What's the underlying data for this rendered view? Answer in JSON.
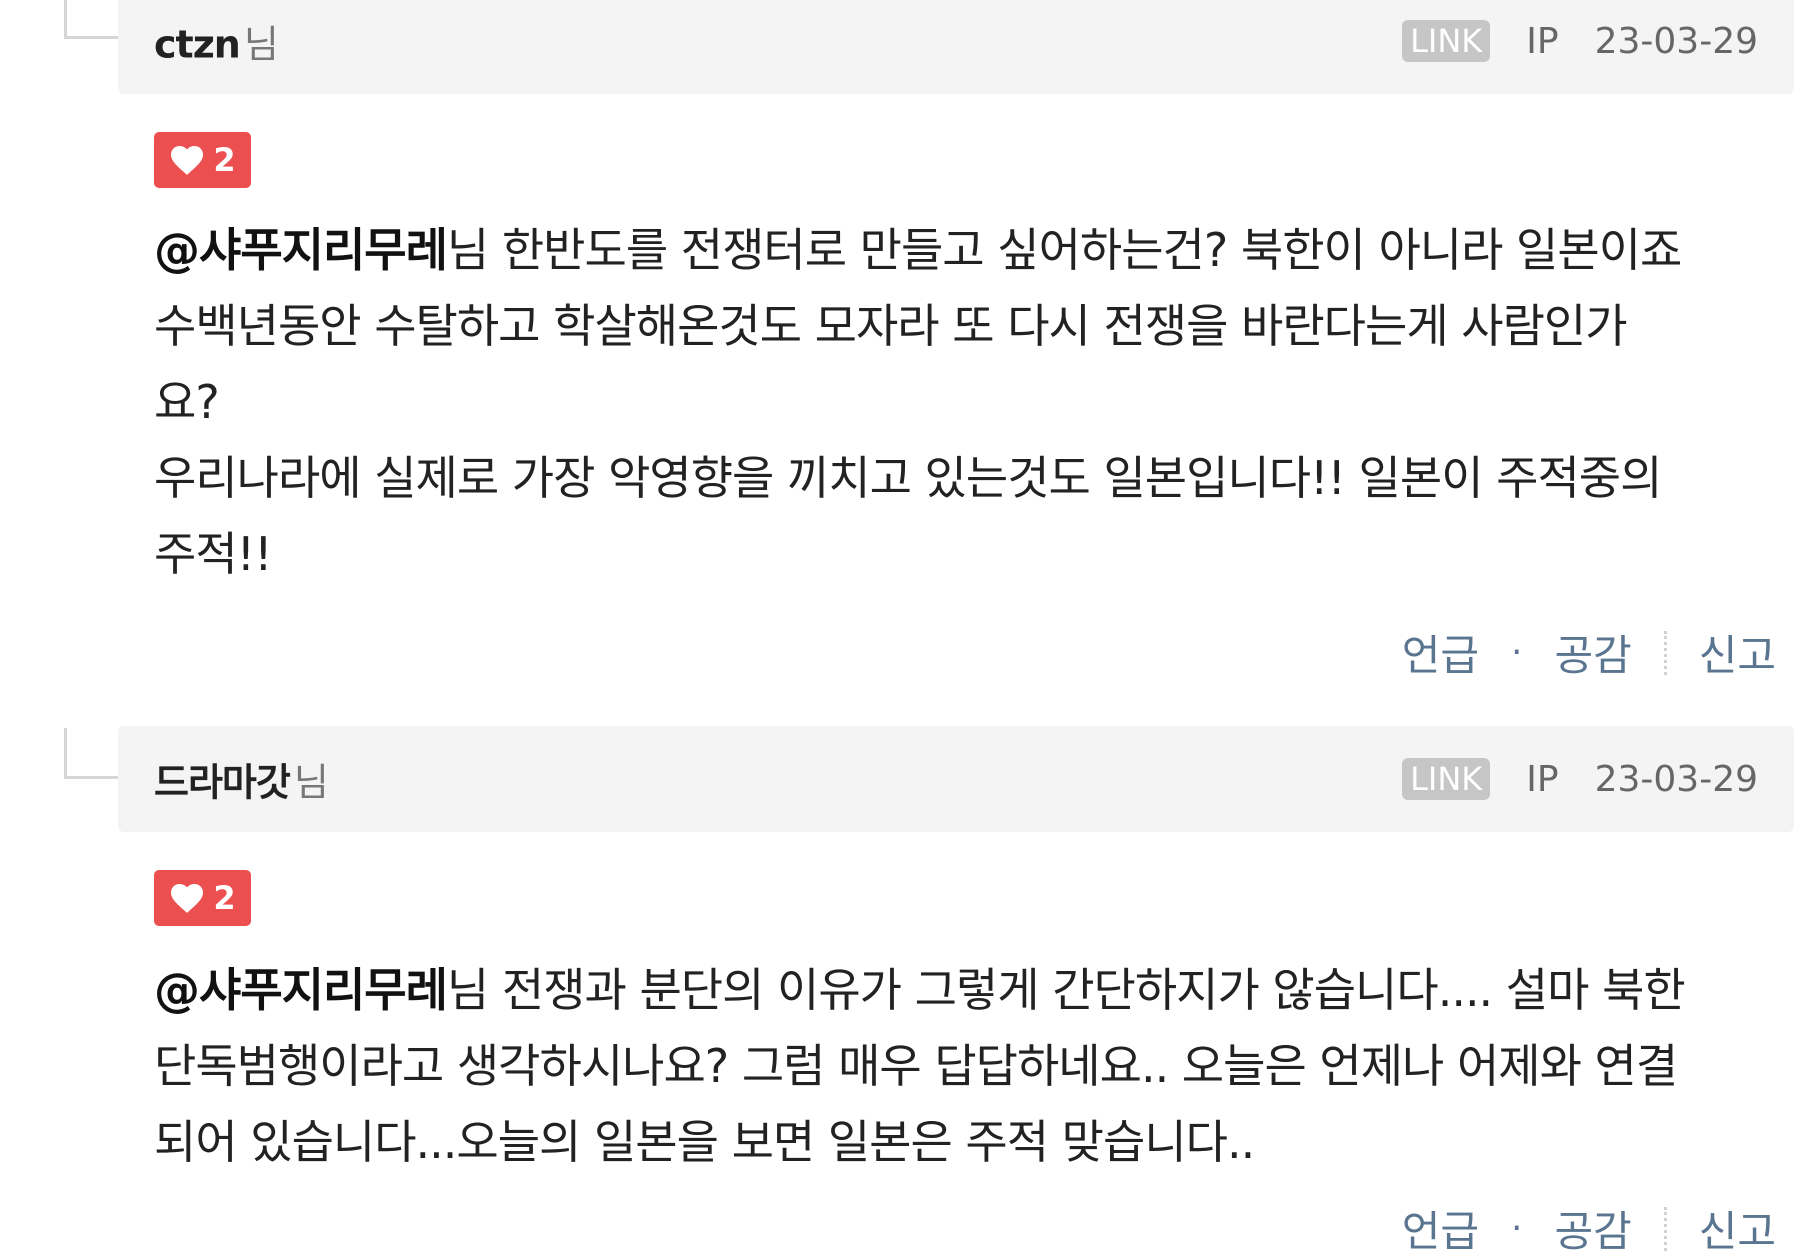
{
  "comments": [
    {
      "author": "ctzn",
      "author_suffix": "님",
      "link_label": "LINK",
      "ip_label": "IP",
      "date": "23-03-29",
      "likes": "2",
      "mention": "@샤푸지리무레",
      "mention_suffix": "님 한반도를 전쟁터로 만들고 싶어하는건? 북한이 아니라 일본이죠",
      "lines": [
        "수백년동안 수탈하고 학살해온것도 모자라 또 다시 전쟁을 바란다는게 사람인가",
        "요?",
        "우리나라에 실제로 가장 악영향을 끼치고 있는것도 일본입니다!! 일본이 주적중의",
        "주적!!"
      ],
      "actions": {
        "mention": "언급",
        "separator": "·",
        "like": "공감",
        "report": "신고"
      }
    },
    {
      "author": "드라마갓",
      "author_suffix": "님",
      "link_label": "LINK",
      "ip_label": "IP",
      "date": "23-03-29",
      "likes": "2",
      "mention": "@샤푸지리무레",
      "mention_suffix": "님 전쟁과 분단의 이유가 그렇게 간단하지가 않습니다.... 설마 북한",
      "lines": [
        "단독범행이라고 생각하시나요? 그럼 매우 답답하네요.. 오늘은 언제나 어제와 연결",
        "되어 있습니다...오늘의 일본을 보면 일본은 주적 맞습니다.."
      ],
      "actions": {
        "mention": "언급",
        "separator": "·",
        "like": "공감",
        "report": "신고"
      }
    }
  ],
  "icons": {
    "like": "heart-icon"
  },
  "colors": {
    "like_badge": "#ec4f50",
    "action_text": "#5a7590",
    "header_bg": "#f4f4f4",
    "link_badge": "#c6c6c6"
  }
}
